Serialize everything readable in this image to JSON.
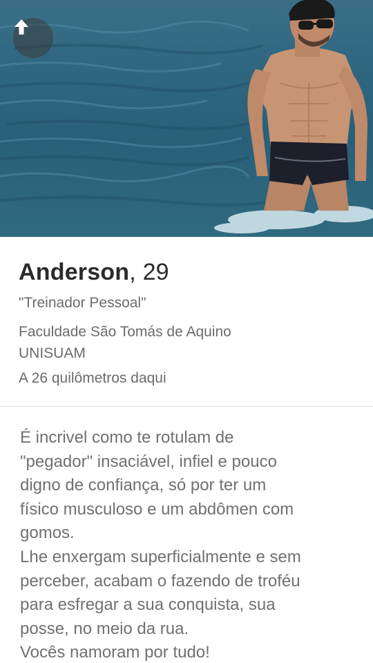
{
  "profile": {
    "name": "Anderson",
    "age_text": ", 29",
    "job": "\"Treinador Pessoal\"",
    "school": "Faculdade São Tomás de Aquino\nUNISUAM",
    "distance": "A 26 quilômetros daqui"
  },
  "bio": {
    "text": "É incrivel como te rotulam de\n\"pegador\" insaciável, infiel e pouco\ndigno de confiança, só por ter um\nfísico musculoso e um abdômen com\ngomos.\nLhe enxergam superficialmente e sem\nperceber, acabam o fazendo de troféu\npara esfregar a sua conquista, sua\nposse, no meio da rua.\nVocês namoram por tudo!"
  },
  "icons": {
    "back": "arrow-up-icon"
  },
  "colors": {
    "name": "#2b2b2b",
    "secondary_text": "#6b6b6b",
    "bio_text": "#707070",
    "divider": "#dedede",
    "back_button_bg": "#3c3c3c"
  }
}
